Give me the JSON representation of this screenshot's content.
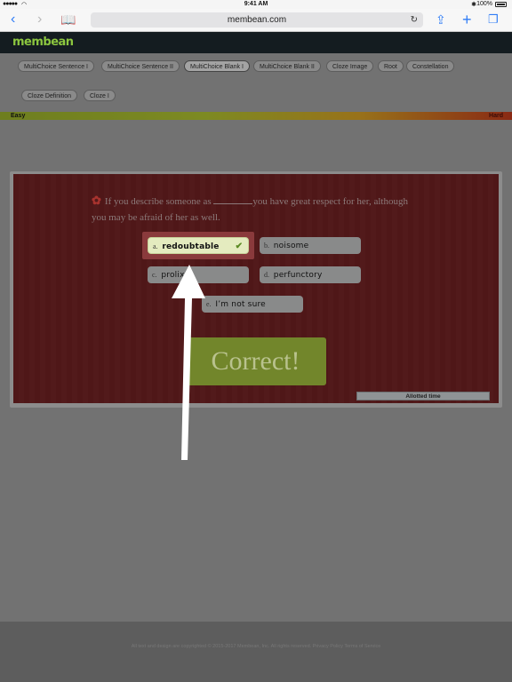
{
  "status_bar": {
    "signal": "●●●●●",
    "time": "9:41 AM",
    "battery": "100%"
  },
  "browser": {
    "url": "membean.com"
  },
  "brand": {
    "logo_text": "membean",
    "logo_color": "#8cc63f"
  },
  "tabs": [
    {
      "label": "MultiChoice Sentence I",
      "active": false
    },
    {
      "label": "MultiChoice Sentence II",
      "active": false
    },
    {
      "label": "MultiChoice Blank I",
      "active": true
    },
    {
      "label": "MultiChoice Blank II",
      "active": false
    },
    {
      "label": "Cloze Image",
      "active": false
    },
    {
      "label": "Root",
      "active": false
    },
    {
      "label": "Constellation",
      "active": false
    },
    {
      "label": "Cloze Definition",
      "active": false
    },
    {
      "label": "Cloze I",
      "active": false
    }
  ],
  "difficulty": {
    "easy_label": "Easy",
    "hard_label": "Hard"
  },
  "question": {
    "before_blank": "If you describe someone as",
    "after_blank": "you have great respect for her, although you may be afraid of her as well."
  },
  "choices": [
    {
      "letter": "a.",
      "word": "redoubtable",
      "state": "correct"
    },
    {
      "letter": "b.",
      "word": "noisome",
      "state": "normal"
    },
    {
      "letter": "c.",
      "word": "prolix",
      "state": "normal"
    },
    {
      "letter": "d.",
      "word": "perfunctory",
      "state": "normal"
    },
    {
      "letter": "e.",
      "word": "I’m not sure",
      "state": "normal"
    }
  ],
  "result": {
    "label": "Correct!",
    "color": "#72862b"
  },
  "timer": {
    "label": "Allotted time"
  },
  "footer": {
    "text": "All text and design are copyrighted © 2015-2017 Membean, Inc. All rights reserved. Privacy Policy Terms of Service"
  }
}
